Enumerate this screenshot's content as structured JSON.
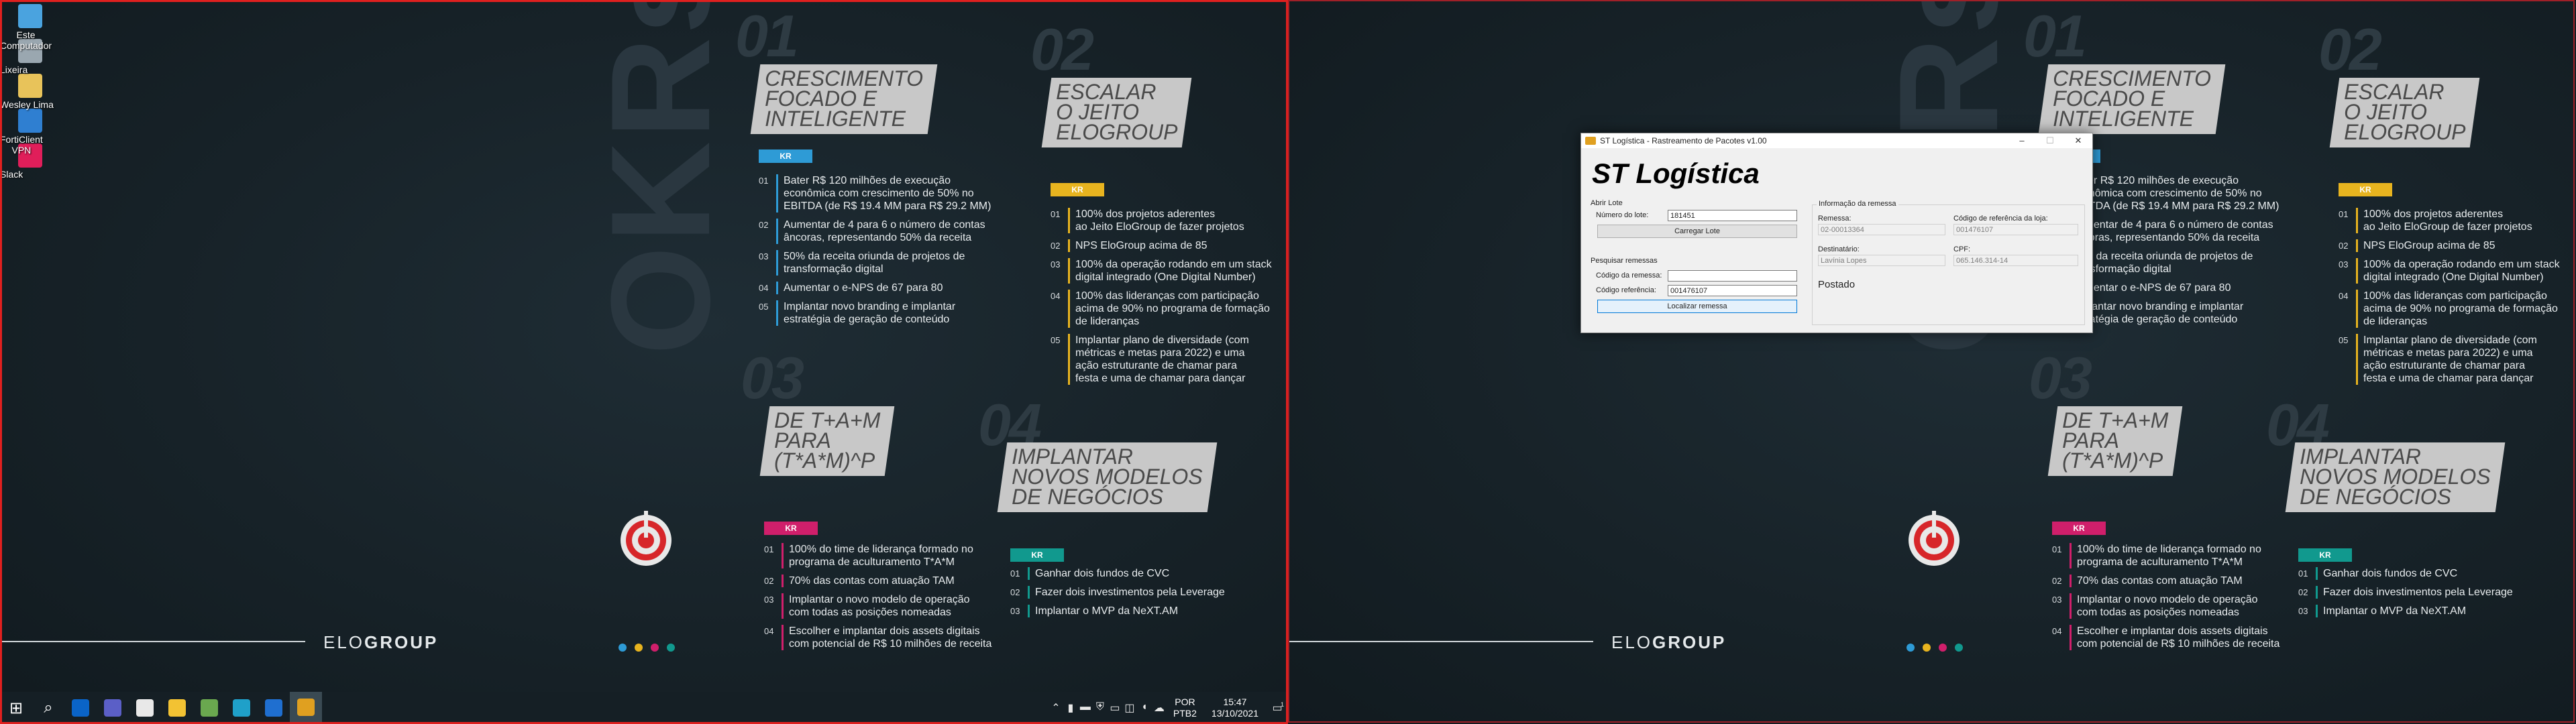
{
  "desktop_icons": [
    {
      "label": "Este\nComputador",
      "icon": "computer-icon",
      "color": "#4aa3df"
    },
    {
      "label": "Lixeira",
      "icon": "recycle-bin-icon",
      "color": "#9aa7b0"
    },
    {
      "label": "Wesley Lima",
      "icon": "user-folder-icon",
      "color": "#e8c35a"
    },
    {
      "label": "FortiClient\nVPN",
      "icon": "forticlient-icon",
      "color": "#2f7fd1"
    },
    {
      "label": "Slack",
      "icon": "slack-icon",
      "color": "#e01e5a"
    }
  ],
  "wallpaper": {
    "brand": "ELOGROUP",
    "brand_light": "ELO",
    "brand_bold": "GROUP",
    "vertical_text": "OKRs",
    "dot_colors": [
      "#2e9bd6",
      "#e8b41f",
      "#d01f6b",
      "#11998e"
    ],
    "blocks": [
      {
        "number": "01",
        "title": "CRESCIMENTO\nFOCADO E\nINTELIGENTE",
        "kr": "KR",
        "color": "#2e9bd6",
        "items": [
          {
            "n": "01",
            "text": "Bater R$ 120 milhões de execução\neconômica com crescimento de 50% no\nEBITDA (de R$ 19.4 MM para R$ 29.2 MM)"
          },
          {
            "n": "02",
            "text": "Aumentar de 4 para 6 o número de contas\nâncoras, representando 50% da receita"
          },
          {
            "n": "03",
            "text": "50% da receita oriunda de projetos de\ntransformação digital"
          },
          {
            "n": "04",
            "text": "Aumentar o e-NPS de 67 para 80"
          },
          {
            "n": "05",
            "text": "Implantar novo branding e implantar\nestratégia de geração de conteúdo"
          }
        ]
      },
      {
        "number": "02",
        "title": "ESCALAR\nO JEITO\nELOGROUP",
        "kr": "KR",
        "color": "#e8b41f",
        "items": [
          {
            "n": "01",
            "text": "100% dos projetos aderentes\nao Jeito EloGroup de fazer projetos"
          },
          {
            "n": "02",
            "text": "NPS EloGroup acima de 85"
          },
          {
            "n": "03",
            "text": "100% da operação rodando em um stack\ndigital integrado (One Digital Number)"
          },
          {
            "n": "04",
            "text": "100% das lideranças com participação\nacima de 90% no programa de formação\nde lideranças"
          },
          {
            "n": "05",
            "text": "Implantar plano de diversidade (com\nmétricas e metas para 2022) e uma\nação estruturante de chamar para\nfesta e uma de chamar para dançar"
          }
        ]
      },
      {
        "number": "03",
        "title": "DE T+A+M\nPARA\n(T*A*M)^P",
        "kr": "KR",
        "color": "#d01f6b",
        "items": [
          {
            "n": "01",
            "text": "100% do time de liderança formado no\nprograma de aculturamento T*A*M"
          },
          {
            "n": "02",
            "text": "70% das contas com atuação TAM"
          },
          {
            "n": "03",
            "text": "Implantar o novo modelo de operação\ncom todas as posições nomeadas"
          },
          {
            "n": "04",
            "text": "Escolher e implantar dois assets digitais\ncom potencial de R$ 10 milhões de receita"
          }
        ]
      },
      {
        "number": "04",
        "title": "IMPLANTAR\nNOVOS MODELOS\nDE NEGÓCIOS",
        "kr": "KR",
        "color": "#11998e",
        "items": [
          {
            "n": "01",
            "text": "Ganhar dois fundos de CVC"
          },
          {
            "n": "02",
            "text": "Fazer dois investimentos pela Leverage"
          },
          {
            "n": "03",
            "text": "Implantar o MVP da NeXT.AM"
          }
        ]
      }
    ]
  },
  "taskbar": {
    "apps": [
      {
        "icon": "windows-start-icon",
        "color": "#ffffff"
      },
      {
        "icon": "search-icon",
        "color": "#ffffff"
      },
      {
        "icon": "outlook-icon",
        "color": "#0a64c8"
      },
      {
        "icon": "teams-icon",
        "color": "#5b5fc7"
      },
      {
        "icon": "chrome-icon",
        "color": "#e8e8e8"
      },
      {
        "icon": "file-explorer-icon",
        "color": "#f2c233"
      },
      {
        "icon": "notepad-icon",
        "color": "#6aa84f"
      },
      {
        "icon": "edge-icon",
        "color": "#1fa0c9"
      },
      {
        "icon": "sourcetree-icon",
        "color": "#1f6fd0"
      },
      {
        "icon": "st-logistica-app-icon",
        "color": "#e0a020"
      }
    ],
    "tray_icons": [
      "chevron-up-icon",
      "microphone-icon",
      "usb-icon",
      "shield-icon",
      "battery-icon",
      "network-icon",
      "speaker-icon",
      "onedrive-icon"
    ],
    "lang_line1": "POR",
    "lang_line2": "PTB2",
    "time": "15:47",
    "date": "13/10/2021",
    "notification_count": "1"
  },
  "dialog": {
    "title": "ST Logística - Rastreamento de Pacotes v1.00",
    "brand": "ST Logística",
    "abrir_lote": {
      "legend": "Abrir Lote",
      "numero_lote_label": "Número do lote:",
      "numero_lote_value": "181451",
      "carregar_label": "Carregar Lote"
    },
    "pesquisar": {
      "legend": "Pesquisar remessas",
      "codigo_remessa_label": "Código da remessa:",
      "codigo_remessa_value": "",
      "codigo_referencia_label": "Código referência:",
      "codigo_referencia_value": "001476107",
      "localizar_label": "Localizar remessa"
    },
    "info": {
      "legend": "Informação da remessa",
      "remessa_label": "Remessa:",
      "remessa_value": "02-00013364",
      "codigo_loja_label": "Código de referência da loja:",
      "codigo_loja_value": "001476107",
      "destinatario_label": "Destinatário:",
      "destinatario_value": "Lavínia Lopes",
      "cpf_label": "CPF:",
      "cpf_value": "065.146.314-14",
      "status": "Postado"
    }
  }
}
